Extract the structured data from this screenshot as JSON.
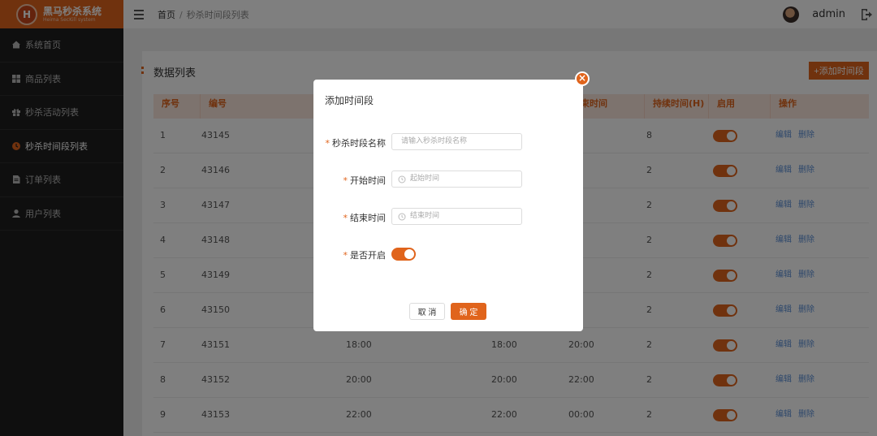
{
  "app": {
    "logo_title": "黑马秒杀系统",
    "logo_subtitle": "Heima SecKill system",
    "logo_mark": "H"
  },
  "sidebar": {
    "items": [
      {
        "label": "系统首页",
        "icon": "home-icon",
        "active": false
      },
      {
        "label": "商品列表",
        "icon": "grid-icon",
        "active": false
      },
      {
        "label": "秒杀活动列表",
        "icon": "gift-icon",
        "active": false
      },
      {
        "label": "秒杀时间段列表",
        "icon": "clock-icon",
        "active": true
      },
      {
        "label": "订单列表",
        "icon": "document-icon",
        "active": false
      },
      {
        "label": "用户列表",
        "icon": "user-icon",
        "active": false
      }
    ]
  },
  "header": {
    "breadcrumb_home": "首页",
    "breadcrumb_sep": "/",
    "breadcrumb_current": "秒杀时间段列表",
    "username": "admin"
  },
  "main": {
    "section_title": "数据列表",
    "add_button": "+添加时间段",
    "columns": [
      "序号",
      "编号",
      "",
      "",
      "束时间",
      "持续时间(H)",
      "启用",
      "操作"
    ],
    "rows": [
      {
        "index": "1",
        "id": "43145",
        "start": "",
        "start2": "",
        "end": "00",
        "duration": "8",
        "enabled": true
      },
      {
        "index": "2",
        "id": "43146",
        "start": "",
        "start2": "",
        "end": "00",
        "duration": "2",
        "enabled": true
      },
      {
        "index": "3",
        "id": "43147",
        "start": "",
        "start2": "",
        "end": "00",
        "duration": "2",
        "enabled": true
      },
      {
        "index": "4",
        "id": "43148",
        "start": "",
        "start2": "",
        "end": "00",
        "duration": "2",
        "enabled": true
      },
      {
        "index": "5",
        "id": "43149",
        "start": "",
        "start2": "",
        "end": "00",
        "duration": "2",
        "enabled": true
      },
      {
        "index": "6",
        "id": "43150",
        "start": "",
        "start2": "",
        "end": "00",
        "duration": "2",
        "enabled": true
      },
      {
        "index": "7",
        "id": "43151",
        "start": "18:00",
        "start2": "18:00",
        "end": "20:00",
        "duration": "2",
        "enabled": true
      },
      {
        "index": "8",
        "id": "43152",
        "start": "20:00",
        "start2": "20:00",
        "end": "22:00",
        "duration": "2",
        "enabled": true
      },
      {
        "index": "9",
        "id": "43153",
        "start": "22:00",
        "start2": "22:00",
        "end": "00:00",
        "duration": "2",
        "enabled": true
      }
    ],
    "edit_label": "编辑",
    "delete_label": "删除"
  },
  "dialog": {
    "title": "添加时间段",
    "close_glyph": "×",
    "name_label": "秒杀时段名称",
    "name_placeholder": "请输入秒杀时段名称",
    "start_label": "开始时间",
    "start_placeholder": "起始时间",
    "end_label": "结束时间",
    "end_placeholder": "结束时间",
    "enabled_label": "是否开启",
    "enabled": true,
    "required_mark": "*",
    "cancel_label": "取 消",
    "ok_label": "确 定"
  },
  "colors": {
    "accent": "#e0641c",
    "sidebar_bg": "#1f1f1f",
    "table_header_bg": "#fbe6dd",
    "link": "#5b8fd6"
  }
}
